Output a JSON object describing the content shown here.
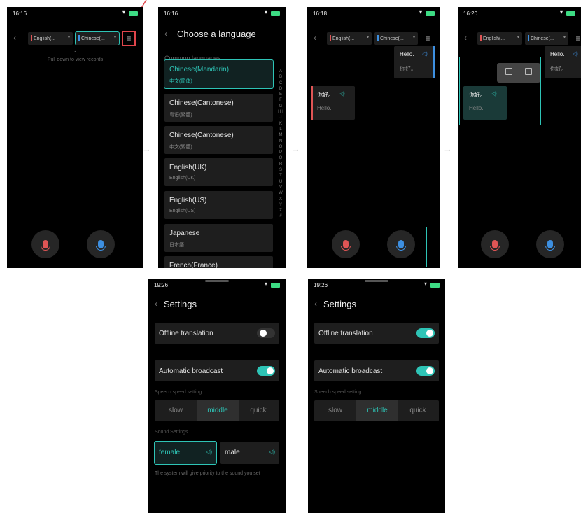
{
  "colors": {
    "accent": "#2ec4b6",
    "highlight": "#e0454b",
    "mic_left": "#e05555",
    "mic_right": "#3d8fe0"
  },
  "icons": {
    "back": "chevron-left-icon",
    "menu": "hamburger-menu-icon",
    "mic": "microphone-icon",
    "speaker": "speaker-icon",
    "wifi": "wifi-icon",
    "battery": "battery-icon",
    "delete": "trash-icon",
    "share": "share-icon",
    "arrow": "right-arrow-icon"
  },
  "glyphs": {
    "back": "‹",
    "menu": "≡",
    "caret": "▾",
    "speaker": "◁)",
    "arrow": "→",
    "up": "⌃"
  },
  "screen1": {
    "time": "16:16",
    "lang_left": "English(...",
    "lang_right": "Chinese(...",
    "pull_hint": "Pull down to view records"
  },
  "screen2": {
    "time": "16:16",
    "title": "Choose a language",
    "section": "Common languages",
    "languages": [
      {
        "name": "Chinese(Mandarin)",
        "sub": "中文(简体)"
      },
      {
        "name": "Chinese(Cantonese)",
        "sub": "粤语(繁體)"
      },
      {
        "name": "Chinese(Cantonese)",
        "sub": "中文(繁體)"
      },
      {
        "name": "English(UK)",
        "sub": "English(UK)"
      },
      {
        "name": "English(US)",
        "sub": "English(US)"
      },
      {
        "name": "Japanese",
        "sub": "日本語"
      },
      {
        "name": "French(France)",
        "sub": ""
      }
    ],
    "alphabet": "A B C D E F G H I J K L M N O P Q R S T U V W X Y Z #"
  },
  "screen3": {
    "time": "16:18",
    "lang_left": "English(...",
    "lang_right": "Chinese(...",
    "bubble_right": {
      "line1": "Hello.",
      "line2": "你好。"
    },
    "bubble_left": {
      "line1": "你好。",
      "line2": "Hello."
    }
  },
  "screen4": {
    "time": "16:20",
    "lang_left": "English(...",
    "lang_right": "Chinese(...",
    "bubble_right": {
      "line1": "Hello.",
      "line2": "你好。"
    },
    "bubble_left": {
      "line1": "你好。",
      "line2": "Hello."
    }
  },
  "screen5": {
    "time": "19:26",
    "title": "Settings",
    "offline": "Offline translation",
    "offline_on": false,
    "broadcast": "Automatic broadcast",
    "broadcast_on": true,
    "speed_label": "Speech speed setting",
    "speeds": [
      "slow",
      "middle",
      "quick"
    ],
    "speed_selected": "middle",
    "sound_label": "Sound Settings",
    "sound_female": "female",
    "sound_male": "male",
    "note": "The system will give priority to the sound you set"
  },
  "screen6": {
    "time": "19:26",
    "title": "Settings",
    "offline": "Offline translation",
    "offline_on": true,
    "broadcast": "Automatic broadcast",
    "broadcast_on": true,
    "speed_label": "Speech speed setting",
    "speeds": [
      "slow",
      "middle",
      "quick"
    ],
    "speed_selected": "middle"
  }
}
